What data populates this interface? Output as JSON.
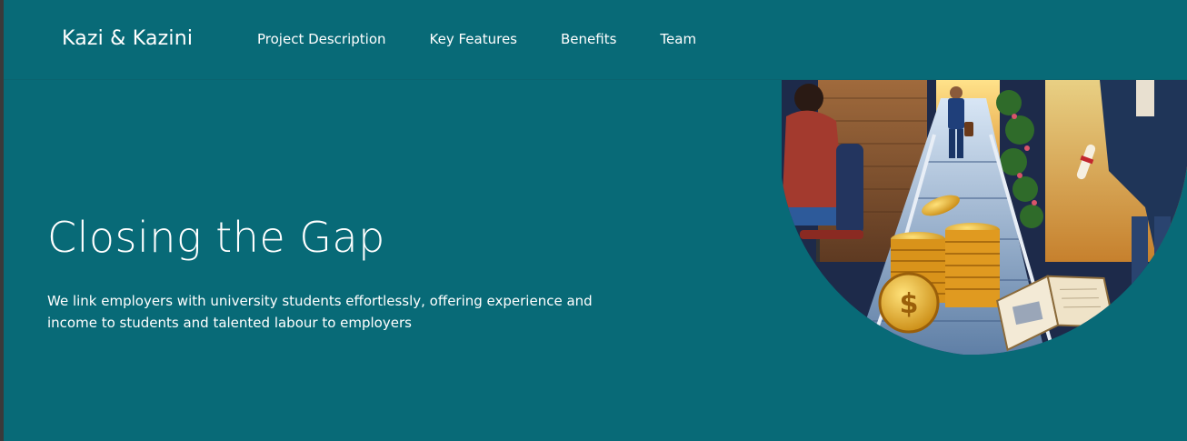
{
  "navbar": {
    "brand": "Kazi & Kazini",
    "links": [
      {
        "label": "Project Description"
      },
      {
        "label": "Key Features"
      },
      {
        "label": "Benefits"
      },
      {
        "label": "Team"
      }
    ]
  },
  "hero": {
    "title": "Closing the Gap",
    "subtitle": "We link employers with university students effortlessly, offering experience and income to students and talented labour to employers"
  },
  "colors": {
    "background": "#086a77",
    "text": "#ffffff"
  }
}
